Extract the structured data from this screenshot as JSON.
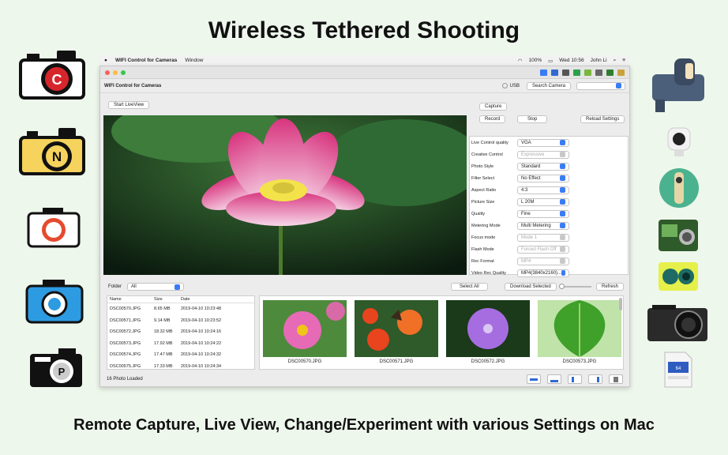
{
  "headline": "Wireless Tethered Shooting",
  "subheadline": "Remote Capture, Live View, Change/Experiment with various Settings on Mac",
  "menubar": {
    "apple": "",
    "app": "WIFI Control for Cameras",
    "menu": "Window",
    "battery": "100%",
    "clock": "Wed 10:56",
    "user": "John Li"
  },
  "toolbar": {
    "app_title": "WIFI Control for Cameras",
    "usb_label": "USB",
    "search_camera": "Search Camera"
  },
  "controls": {
    "start_liveview": "Start LiveView",
    "capture": "Capture",
    "record": "Record",
    "stop": "Stop",
    "reload_settings": "Reload Settings"
  },
  "settings": [
    {
      "label": "Live Control quality",
      "value": "VGA",
      "enabled": true
    },
    {
      "label": "Creative Control",
      "value": "Expressive",
      "enabled": false
    },
    {
      "label": "Photo Style",
      "value": "Standard",
      "enabled": true
    },
    {
      "label": "Filter Select",
      "value": "No Effect",
      "enabled": true
    },
    {
      "label": "Aspect Ratio",
      "value": "4:3",
      "enabled": true
    },
    {
      "label": "Picture Size",
      "value": "L 20M",
      "enabled": true
    },
    {
      "label": "Quality",
      "value": "Fine",
      "enabled": true
    },
    {
      "label": "Metering Mode",
      "value": "Multi Metering",
      "enabled": true
    },
    {
      "label": "Focus mode",
      "value": "Mode 1",
      "enabled": false
    },
    {
      "label": "Flash Mode",
      "value": "Forced Flash Off",
      "enabled": false
    },
    {
      "label": "Rec Format",
      "value": "MP4",
      "enabled": false
    },
    {
      "label": "Video Rec Quality",
      "value": "MP4(3840x2160)...",
      "enabled": true
    }
  ],
  "browser": {
    "folder_label": "Folder",
    "folder_value": "All",
    "select_all": "Select All",
    "download_selected": "Download Selected",
    "refresh": "Refresh",
    "columns": [
      "Name",
      "Size",
      "Date"
    ],
    "files": [
      [
        "DSC00570.JPG",
        "8.65 MB",
        "2019-04-10 10:23:48"
      ],
      [
        "DSC00571.JPG",
        "9.14 MB",
        "2019-04-10 10:23:52"
      ],
      [
        "DSC00572.JPG",
        "18.32 MB",
        "2019-04-10 10:24:16"
      ],
      [
        "DSC00573.JPG",
        "17.92 MB",
        "2019-04-10 10:24:22"
      ],
      [
        "DSC00574.JPG",
        "17.47 MB",
        "2019-04-10 10:24:32"
      ],
      [
        "DSC00575.JPG",
        "17.33 MB",
        "2019-04-10 10:24:34"
      ]
    ],
    "thumbnails": [
      "DSC00570.JPG",
      "DSC00571.JPG",
      "DSC00572.JPG",
      "DSC00573.JPG"
    ]
  },
  "status": {
    "photos_loaded": "16 Photo Loaded"
  },
  "side_icons_left": [
    "camera-c-icon",
    "camera-n-icon",
    "camera-red-icon",
    "camera-blue-icon",
    "camera-p-icon"
  ],
  "side_icons_right": [
    "camcorder-icon",
    "action-cam-white-icon",
    "360-cam-icon",
    "action-cam-green-icon",
    "action-cam-yellow-icon",
    "compact-camera-icon",
    "sd-card-icon"
  ]
}
